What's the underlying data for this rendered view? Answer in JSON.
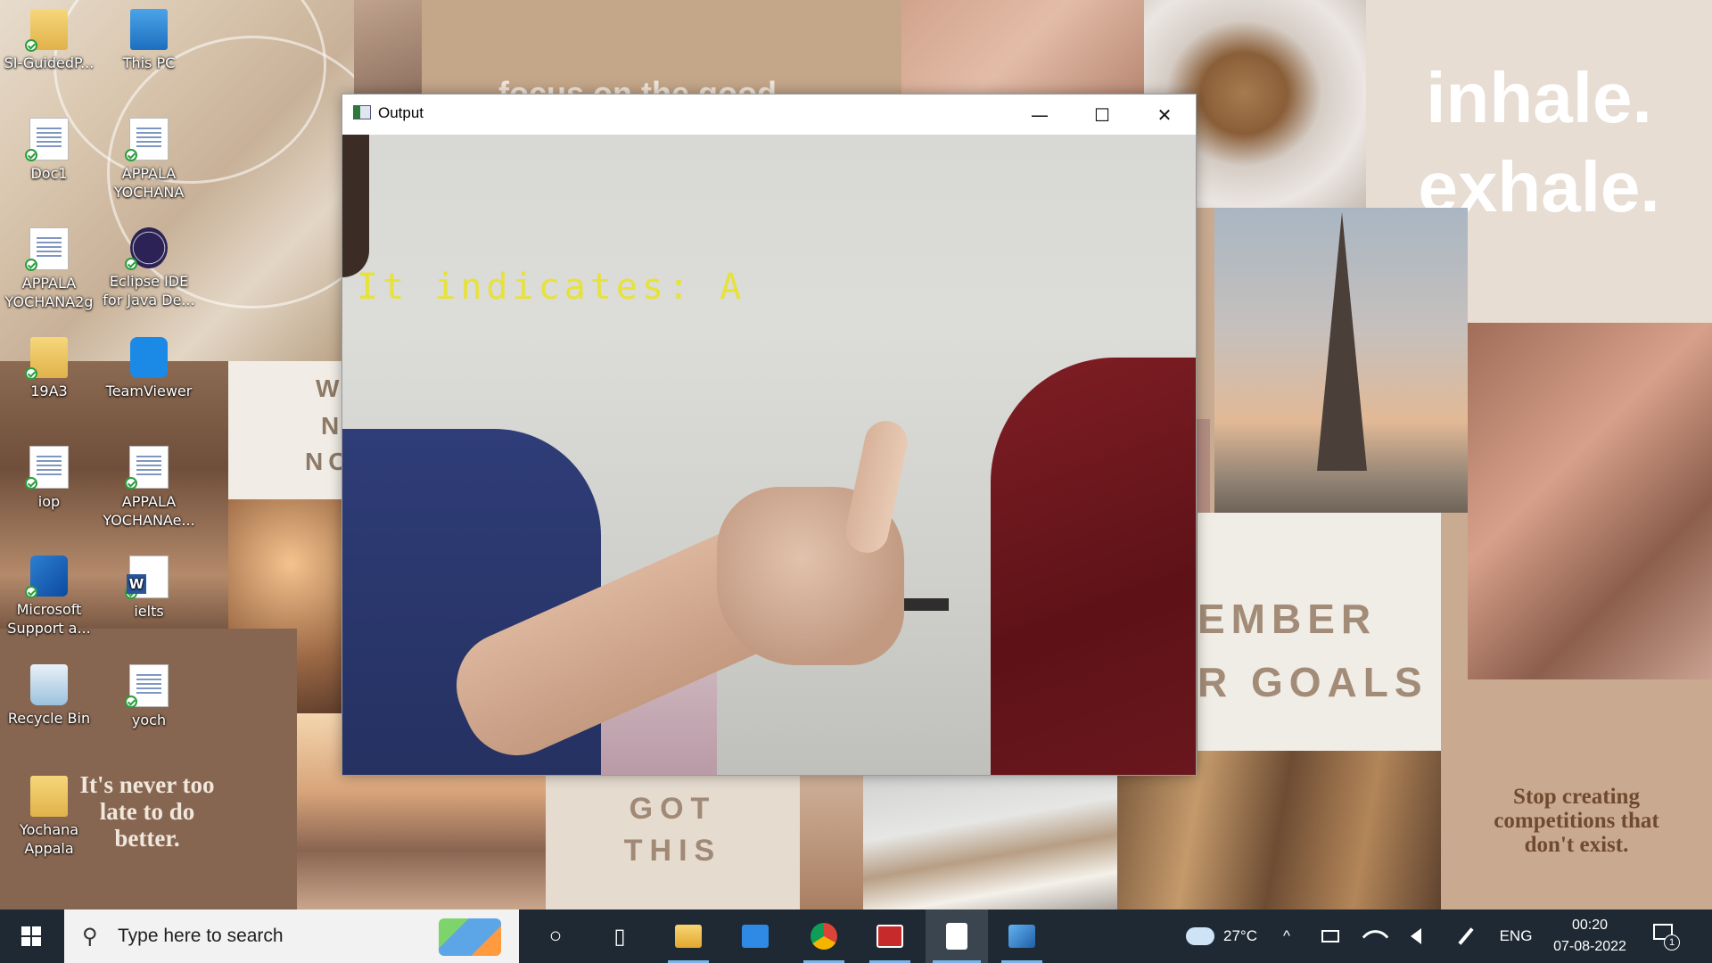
{
  "wallpaper": {
    "focus_text": "focus on the good",
    "inhale_line1": "inhale.",
    "inhale_line2": "exhale.",
    "words_card": [
      "W",
      "N",
      "NO"
    ],
    "remember_line1": "EMBER",
    "remember_line2": "R GOALS",
    "gotthis_line1": "GOT",
    "gotthis_line2": "THIS",
    "quote_left": "It's never too late to do better.",
    "quote_right": "Stop creating competitions that don't exist."
  },
  "desktop_icons": [
    {
      "label": "SI-GuidedP...",
      "icon": "folder-icon"
    },
    {
      "label": "This PC",
      "icon": "computer-icon"
    },
    {
      "label": "Doc1",
      "icon": "document-icon"
    },
    {
      "label": "APPALA YOCHANA",
      "icon": "document-icon"
    },
    {
      "label": "APPALA YOCHANA2g",
      "icon": "document-icon"
    },
    {
      "label": "Eclipse IDE for Java De...",
      "icon": "eclipse-icon"
    },
    {
      "label": "19A3",
      "icon": "folder-icon"
    },
    {
      "label": "TeamViewer",
      "icon": "teamviewer-icon"
    },
    {
      "label": "iop",
      "icon": "document-icon"
    },
    {
      "label": "APPALA YOCHANAe...",
      "icon": "document-icon"
    },
    {
      "label": "Microsoft Support a...",
      "icon": "microsoft-support-icon"
    },
    {
      "label": "ielts",
      "icon": "word-document-icon"
    },
    {
      "label": "Recycle Bin",
      "icon": "recycle-bin-icon"
    },
    {
      "label": "yoch",
      "icon": "document-icon"
    },
    {
      "label": "Yochana Appala",
      "icon": "user-folder-icon"
    }
  ],
  "window": {
    "title": "Output",
    "overlay_text": "It indicates: A",
    "minimize_glyph": "—",
    "maximize_glyph": "☐",
    "close_glyph": "✕"
  },
  "taskbar": {
    "search_placeholder": "Type here to search",
    "search_glyph": "⚲",
    "cortana_glyph": "○",
    "taskview_glyph": "▯",
    "apps": [
      "file-explorer-icon",
      "mail-icon",
      "chrome-icon",
      "app-icon",
      "notepad-icon",
      "photos-icon"
    ],
    "weather": "27°C",
    "chevron_glyph": "^",
    "language": "ENG",
    "time": "00:20",
    "date": "07-08-2022",
    "notification_count": "1",
    "colors": {
      "bar": "#1f2933",
      "search": "#f2f2f2",
      "accent": "#7ab3e8"
    }
  }
}
